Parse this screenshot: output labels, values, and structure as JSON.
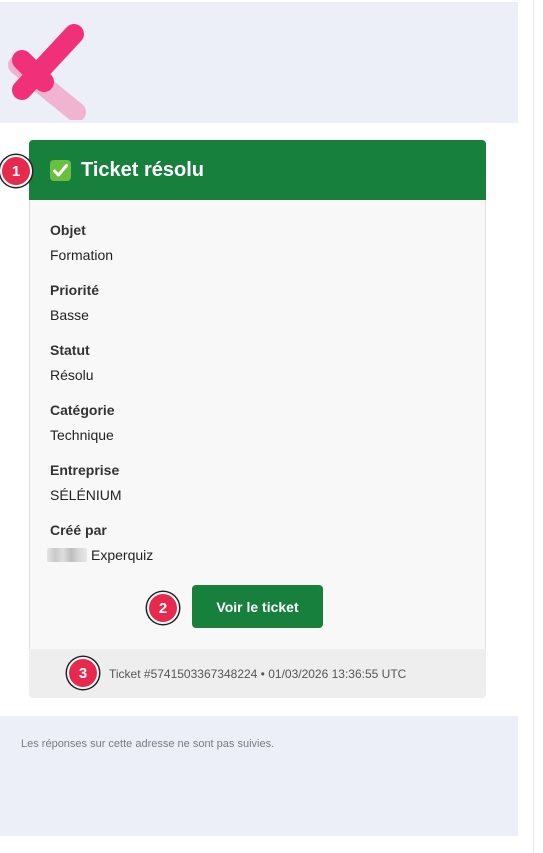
{
  "card": {
    "title_icon": "white-heavy-check-mark-icon",
    "title": "Ticket résolu",
    "fields": [
      {
        "label": "Objet",
        "value": "Formation"
      },
      {
        "label": "Priorité",
        "value": "Basse"
      },
      {
        "label": "Statut",
        "value": "Résolu"
      },
      {
        "label": "Catégorie",
        "value": "Technique"
      },
      {
        "label": "Entreprise",
        "value": "SÉLÉNIUM"
      },
      {
        "label": "Créé par",
        "value": "Experquiz"
      }
    ],
    "button_label": "Voir le ticket",
    "footer": "Ticket #5741503367348224 • 01/03/2026 13:36:55 UTC"
  },
  "markers": [
    "1",
    "2",
    "3"
  ],
  "bottom_note": "Les réponses sur cette adresse ne sont pas suivies.",
  "colors": {
    "header_green": "#17803d",
    "marker_red": "#e8294e",
    "logo_pink": "#f0317a",
    "logo_pink_light": "#f0b3d0",
    "band_bg": "#eceff7"
  }
}
